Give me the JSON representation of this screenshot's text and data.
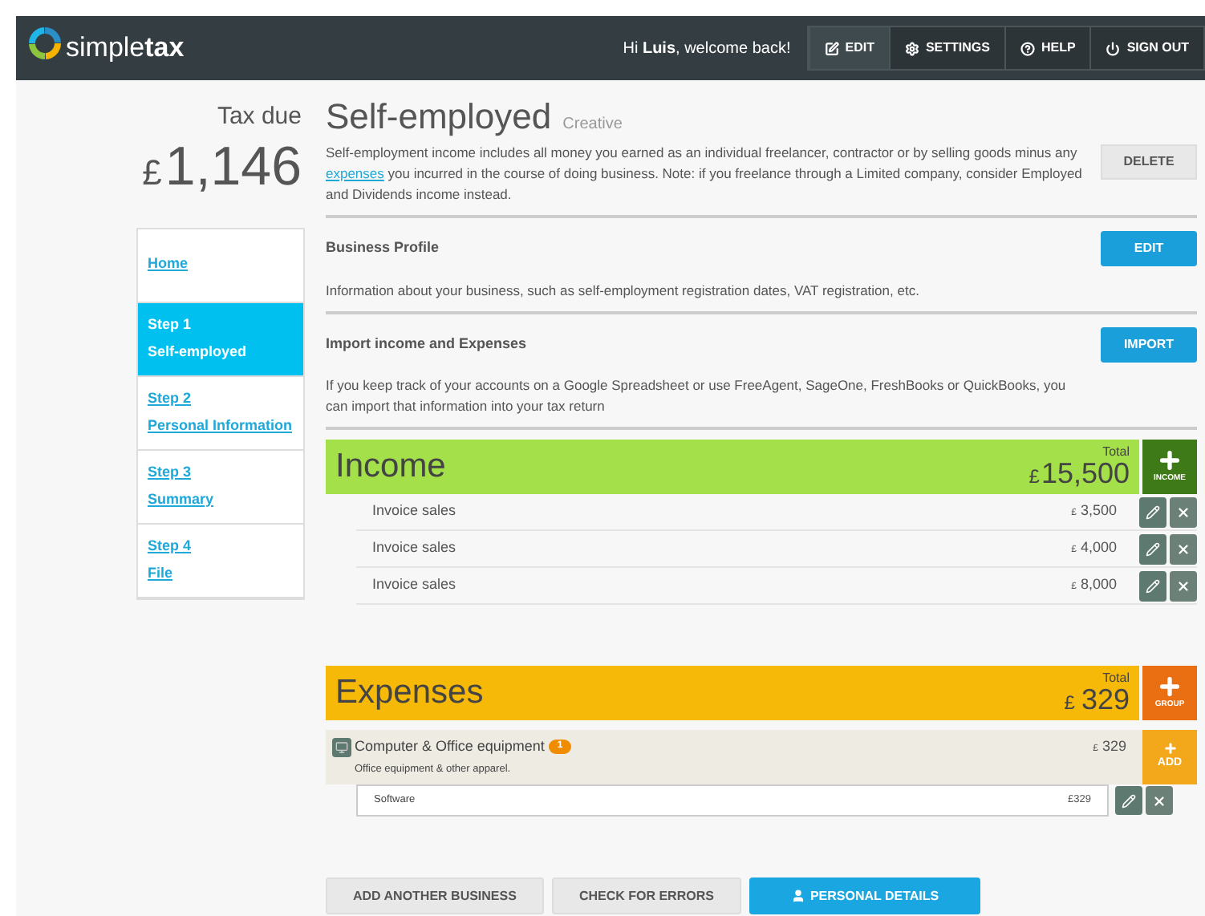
{
  "header": {
    "brand": "simple**tax**",
    "welcome": "Hi **Luis**, welcome back!",
    "nav": [
      {
        "kind": "edit",
        "label": "EDIT",
        "selected": true
      },
      {
        "kind": "settings",
        "label": "SETTINGS",
        "selected": false
      },
      {
        "kind": "help",
        "label": "HELP",
        "selected": false
      },
      {
        "kind": "signout",
        "label": "SIGN OUT",
        "selected": false
      }
    ]
  },
  "tax_due": {
    "label": "Tax due",
    "currency": "£",
    "amount": "1,146"
  },
  "sidebar": {
    "items": [
      {
        "label": "Home",
        "selected": false
      },
      {
        "step": "Step 1",
        "label": "Self-employed",
        "selected": true
      },
      {
        "step": "Step 2",
        "label": "Personal Information",
        "selected": false
      },
      {
        "step": "Step 3",
        "label": "Summary",
        "selected": false
      },
      {
        "step": "Step 4",
        "label": "File",
        "selected": false
      }
    ]
  },
  "business": {
    "title": "Self-employed",
    "subtitle": "Creative",
    "description": [
      {
        "kind": "text",
        "text": "Self-employment income includes all money you earned as an individual freelancer, contractor or by selling goods minus any "
      },
      {
        "kind": "link",
        "text": "expenses"
      },
      {
        "kind": "text",
        "text": " you incurred in the course of doing business. Note: if you freelance through a Limited company, consider Employed and Dividends income instead."
      }
    ],
    "delete_button": "DELETE"
  },
  "sections": [
    {
      "title": "Business Profile",
      "text": "Information about your business, such as self-employment registration dates, VAT registration, etc.",
      "button": "EDIT"
    },
    {
      "title": "Import income and Expenses",
      "text": "If you keep track of your accounts on a Google Spreadsheet or use FreeAgent, SageOne, FreshBooks or QuickBooks, you can import that information into your tax return",
      "button": "IMPORT"
    }
  ],
  "income": {
    "title": "Income",
    "total_label": "Total",
    "currency": "£",
    "total": "15,500",
    "add_label": "INCOME",
    "rows": [
      {
        "label": "Invoice sales",
        "currency": "£",
        "amount": "3,500"
      },
      {
        "label": "Invoice sales",
        "currency": "£",
        "amount": "4,000"
      },
      {
        "label": "Invoice sales",
        "currency": "£",
        "amount": "8,000"
      }
    ]
  },
  "expenses": {
    "title": "Expenses",
    "total_label": "Total",
    "currency": "£",
    "total": "329",
    "add_label": "GROUP",
    "groups": [
      {
        "name": "Computer & Office equipment",
        "count": "1",
        "description": "Office equipment & other apparel.",
        "currency": "£",
        "amount": "329",
        "add_label": "ADD",
        "rows": [
          {
            "label": "Software",
            "amount": "£329"
          }
        ]
      }
    ]
  },
  "footer_buttons": [
    {
      "kind": "plain",
      "label": "ADD ANOTHER BUSINESS"
    },
    {
      "kind": "plain",
      "label": "CHECK FOR ERRORS"
    },
    {
      "kind": "primary",
      "label": "PERSONAL DETAILS"
    }
  ]
}
